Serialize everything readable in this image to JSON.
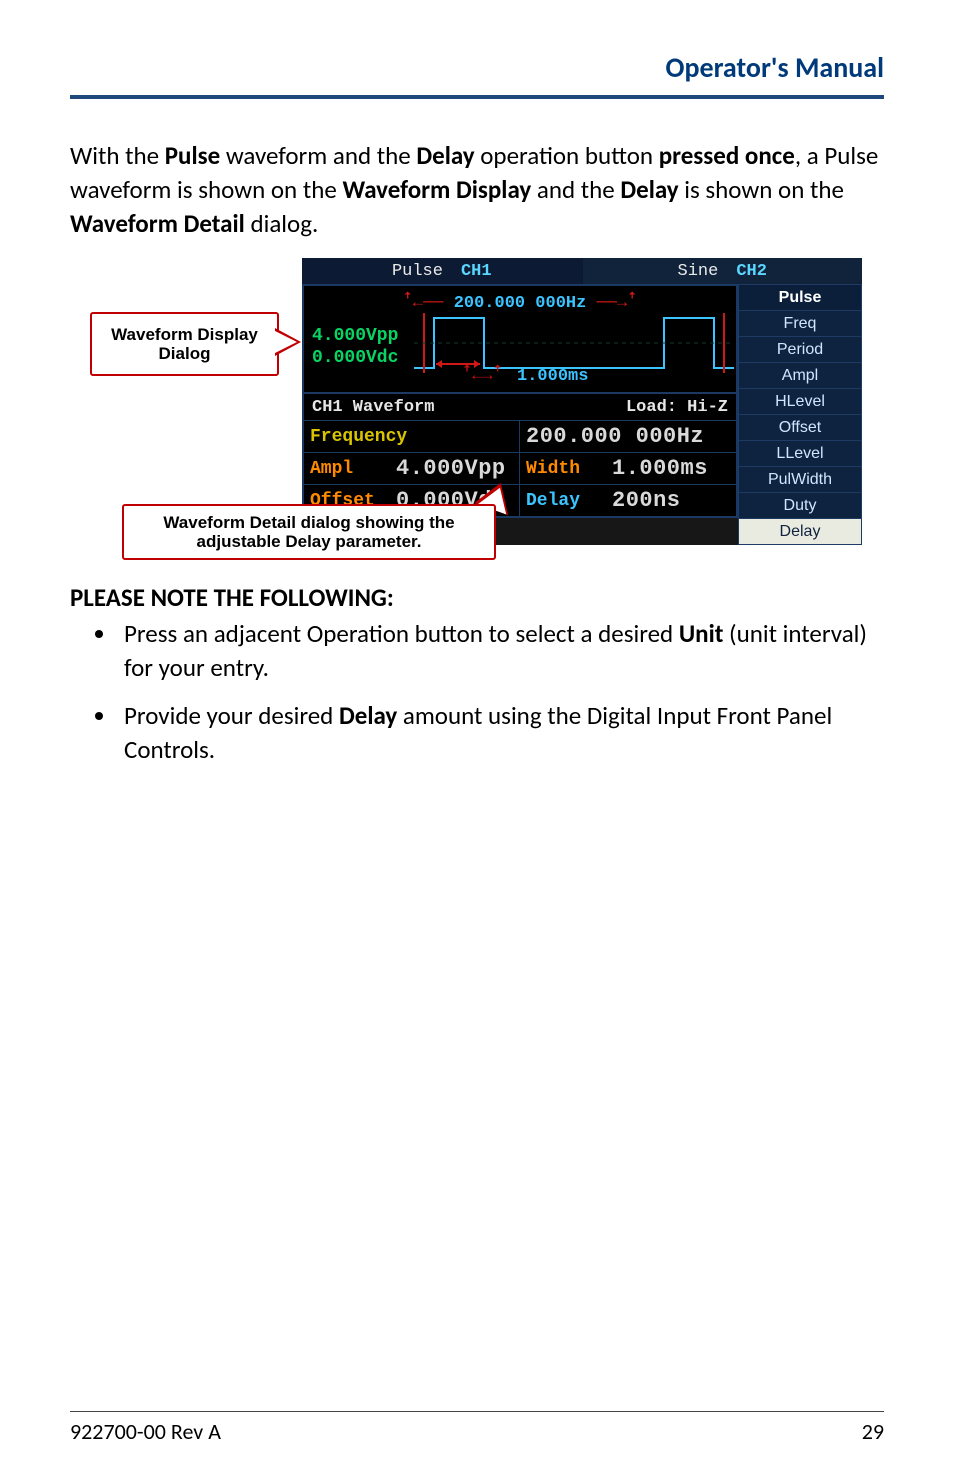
{
  "header": {
    "title": "Operator's Manual"
  },
  "body": {
    "para_parts": [
      "With the ",
      "Pulse",
      " waveform and the ",
      "Delay",
      " operation button ",
      "pressed once",
      ", a Pulse waveform is shown on the ",
      "Waveform Display",
      " and the ",
      "Delay",
      " is shown on the ",
      "Waveform Detail",
      " dialog."
    ],
    "note_heading_text": "PLEASE NOTE THE FOLLOWING",
    "note_heading_colon": ":",
    "bullets": [
      {
        "pre": "Press an adjacent Operation button to select a desired ",
        "b": "Unit",
        "post": " (unit interval) for your entry."
      },
      {
        "pre": "Provide your desired ",
        "b": "Delay",
        "post": " amount using the Digital Input Front Panel Controls."
      }
    ]
  },
  "figure": {
    "callout_display_l1": "Waveform Display",
    "callout_display_l2": "Dialog",
    "callout_detail_l1": "Waveform Detail dialog showing the",
    "callout_detail_l2": "adjustable Delay parameter.",
    "tabs": {
      "ch1": {
        "name": "Pulse",
        "ch": "CH1"
      },
      "ch2": {
        "name": "Sine",
        "ch": "CH2"
      }
    },
    "side_menu": {
      "title": "Pulse",
      "items": [
        "Freq",
        "Period",
        "Ampl",
        "HLevel",
        "Offset",
        "LLevel",
        "PulWidth",
        "Duty",
        "Delay"
      ],
      "selected": "Delay"
    },
    "wf_display": {
      "vpp": "4.000Vpp",
      "vdc": "0.000Vdc",
      "freq_arrow_l": "ꜟ←",
      "freq": "200.000 000Hz",
      "freq_arrow_r": "→ꜟ",
      "period_arrow": "ꜟ←→ꜟ",
      "period": "1.000ms"
    },
    "detail": {
      "hdr_left": "CH1 Waveform",
      "hdr_right": "Load: Hi-Z",
      "rows": [
        {
          "l_lbl": "Frequency",
          "l_val": "",
          "r_lbl": "",
          "r_val": "200.000 000Hz"
        },
        {
          "l_lbl": "Ampl",
          "l_val": "4.000Vpp",
          "r_lbl": "Width",
          "r_val": "1.000ms"
        },
        {
          "l_lbl": "Offset",
          "l_val": "0.000Vdc",
          "r_lbl": "Delay",
          "r_val": "200ns"
        }
      ]
    }
  },
  "footer": {
    "left": "922700-00 Rev A",
    "right": "29"
  }
}
